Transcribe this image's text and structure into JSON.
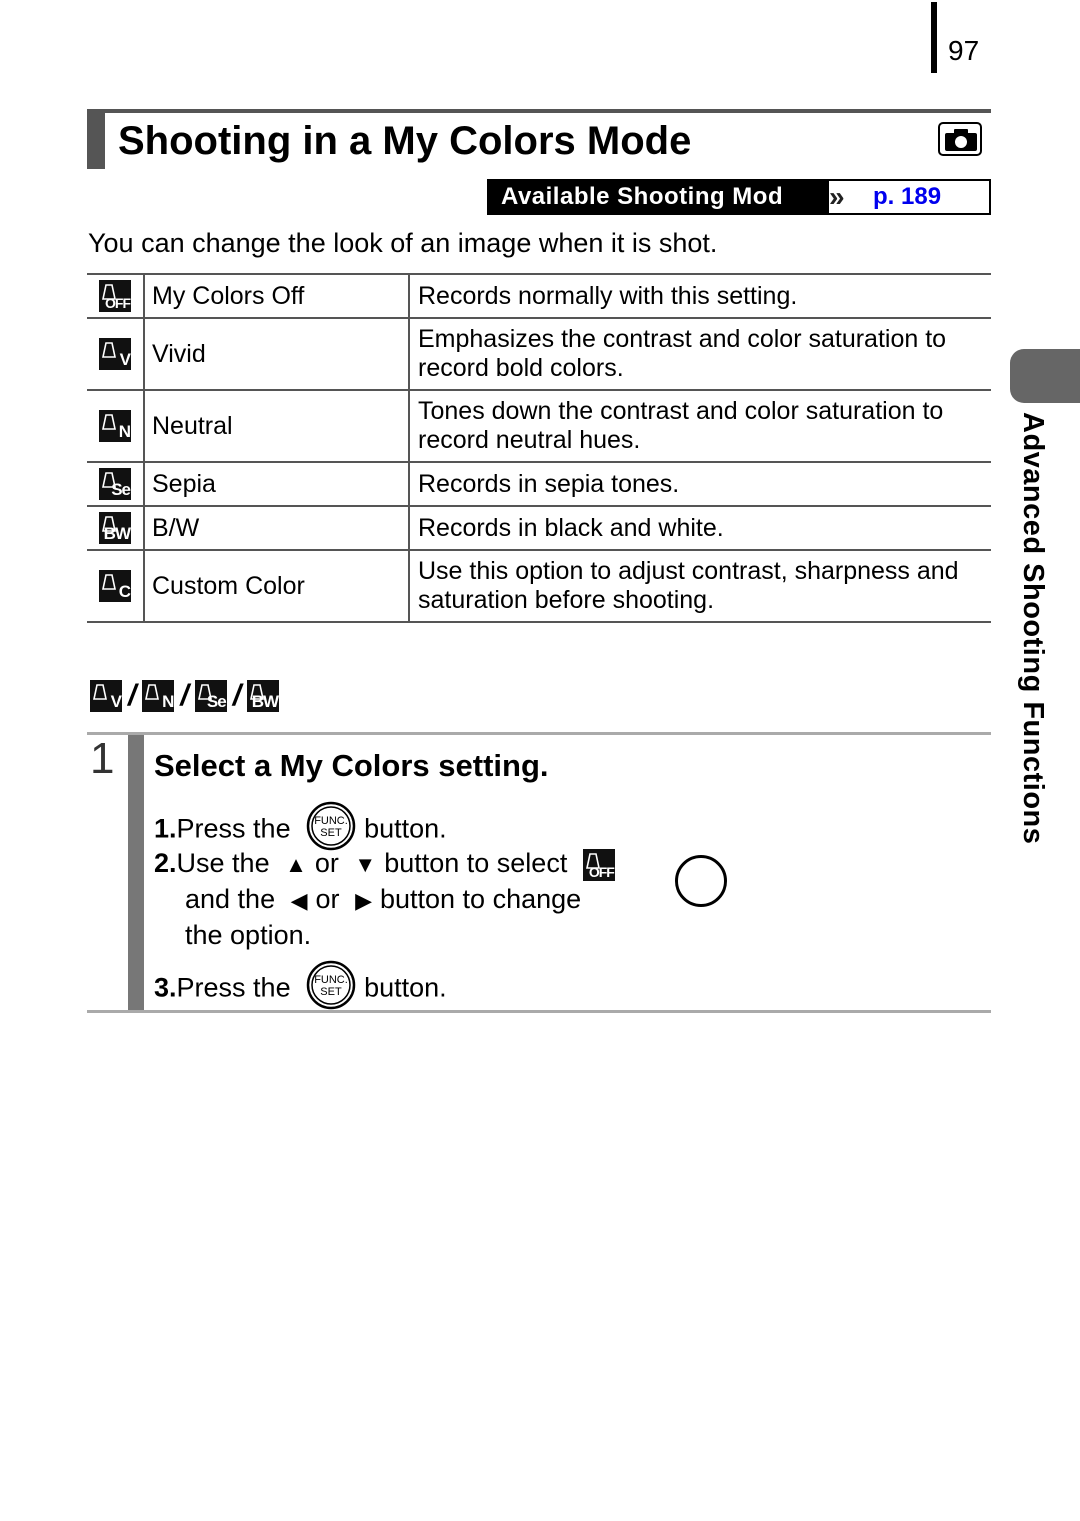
{
  "page": {
    "number": "97",
    "title": "Shooting in a My Colors Mode",
    "mode_icon": "camera-icon",
    "available_modes": {
      "label": "Available Shooting Mod",
      "arrow_icon": "double-chevron-right-icon",
      "link": "p. 189",
      "link_color": "#0000ee"
    },
    "intro": "You can change the look of an image when it is shot.",
    "side_tab": "Advanced Shooting Functions"
  },
  "modes_table": [
    {
      "icon": "my-colors-off-icon",
      "suffix": "OFF",
      "name": "My Colors Off",
      "description": "Records normally with this setting."
    },
    {
      "icon": "my-colors-vivid-icon",
      "suffix": "V",
      "name": "Vivid",
      "description": "Emphasizes the contrast and color saturation to record bold colors."
    },
    {
      "icon": "my-colors-neutral-icon",
      "suffix": "N",
      "name": "Neutral",
      "description": "Tones down the contrast and color saturation to record neutral hues."
    },
    {
      "icon": "my-colors-sepia-icon",
      "suffix": "Se",
      "name": "Sepia",
      "description": "Records in sepia tones."
    },
    {
      "icon": "my-colors-bw-icon",
      "suffix": "BW",
      "name": "B/W",
      "description": "Records in black and white."
    },
    {
      "icon": "my-colors-custom-icon",
      "suffix": "C",
      "name": "Custom Color",
      "description": "Use this option to adjust contrast, sharpness and saturation before shooting."
    }
  ],
  "applicable_icons": [
    {
      "icon": "my-colors-vivid-icon",
      "suffix": "V"
    },
    {
      "icon": "my-colors-neutral-icon",
      "suffix": "N"
    },
    {
      "icon": "my-colors-sepia-icon",
      "suffix": "Se"
    },
    {
      "icon": "my-colors-bw-icon",
      "suffix": "BW"
    }
  ],
  "separator": "/",
  "step": {
    "number": "1",
    "title": "Select a My Colors setting.",
    "sub1": {
      "num": "1.",
      "pre": "Press the",
      "button_icon": "func-set-button-icon",
      "post": "button."
    },
    "sub2": {
      "num": "2.",
      "line1_pre": "Use the",
      "up_icon": "up-arrow-icon",
      "or1": "or",
      "down_icon": "down-arrow-icon",
      "line1_post": "button to select",
      "select_icon": "my-colors-off-icon",
      "select_suffix": "OFF",
      "line2_pre": "and the",
      "left_icon": "left-arrow-icon",
      "or2": "or",
      "right_icon": "right-arrow-icon",
      "line2_post": "button to change",
      "line3": "the option."
    },
    "sub3": {
      "num": "3.",
      "pre": "Press the",
      "button_icon": "func-set-button-icon",
      "post": "button."
    }
  }
}
